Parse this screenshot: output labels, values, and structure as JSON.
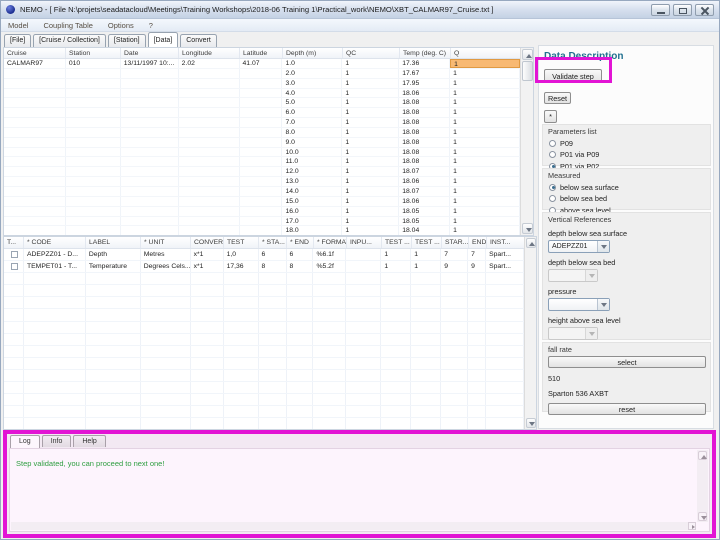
{
  "window": {
    "title": "NEMO - [ File N:\\projets\\seadatacloud\\Meetings\\Training Workshops\\2018-06 Training 1\\Practical_work\\NEMO\\XBT_CALMAR97_Cruise.txt ]"
  },
  "menu": {
    "items": [
      "Model",
      "Coupling Table",
      "Options",
      "?"
    ]
  },
  "tabs": {
    "items": [
      "[File]",
      "[Cruise / Collection]",
      "[Station]",
      "[Data]",
      "Convert"
    ],
    "active": "[Data]"
  },
  "data_table": {
    "columns": [
      "Cruise",
      "Station",
      "Date",
      "Longitude",
      "Latitude",
      "Depth (m)",
      "QC",
      "Temp (deg. C)",
      "Q"
    ],
    "station_info": {
      "cruise": "CALMAR97",
      "station": "010",
      "date": "13/11/1997 10:...",
      "longitude": "2.02",
      "latitude": "41.07"
    },
    "measurements": [
      {
        "depth": "1.0",
        "qc": "1",
        "temp": "17.36",
        "q": "1"
      },
      {
        "depth": "2.0",
        "qc": "1",
        "temp": "17.67",
        "q": "1"
      },
      {
        "depth": "3.0",
        "qc": "1",
        "temp": "17.95",
        "q": "1"
      },
      {
        "depth": "4.0",
        "qc": "1",
        "temp": "18.06",
        "q": "1"
      },
      {
        "depth": "5.0",
        "qc": "1",
        "temp": "18.08",
        "q": "1"
      },
      {
        "depth": "6.0",
        "qc": "1",
        "temp": "18.08",
        "q": "1"
      },
      {
        "depth": "7.0",
        "qc": "1",
        "temp": "18.08",
        "q": "1"
      },
      {
        "depth": "8.0",
        "qc": "1",
        "temp": "18.08",
        "q": "1"
      },
      {
        "depth": "9.0",
        "qc": "1",
        "temp": "18.08",
        "q": "1"
      },
      {
        "depth": "10.0",
        "qc": "1",
        "temp": "18.08",
        "q": "1"
      },
      {
        "depth": "11.0",
        "qc": "1",
        "temp": "18.08",
        "q": "1"
      },
      {
        "depth": "12.0",
        "qc": "1",
        "temp": "18.07",
        "q": "1"
      },
      {
        "depth": "13.0",
        "qc": "1",
        "temp": "18.06",
        "q": "1"
      },
      {
        "depth": "14.0",
        "qc": "1",
        "temp": "18.07",
        "q": "1"
      },
      {
        "depth": "15.0",
        "qc": "1",
        "temp": "18.06",
        "q": "1"
      },
      {
        "depth": "16.0",
        "qc": "1",
        "temp": "18.05",
        "q": "1"
      },
      {
        "depth": "17.0",
        "qc": "1",
        "temp": "18.05",
        "q": "1"
      },
      {
        "depth": "18.0",
        "qc": "1",
        "temp": "18.04",
        "q": "1"
      }
    ]
  },
  "param_table": {
    "columns": [
      "T...",
      "* CODE",
      "LABEL",
      "* UNIT",
      "CONVER...",
      "TEST",
      "* STA...",
      "* END",
      "* FORMAT",
      "INPU...",
      "TEST ...",
      "TEST ...",
      "STAR...",
      "END ...",
      "INST..."
    ],
    "rows": [
      [
        "ADEPZZ01 - D...",
        "Depth",
        "Metres",
        "x*1",
        "1,0",
        "6",
        "6",
        "%6.1f",
        "",
        "1",
        "1",
        "7",
        "7",
        "Spart..."
      ],
      [
        "TEMPET01 - T...",
        "Temperature",
        "Degrees Cels...",
        "x*1",
        "17,36",
        "8",
        "8",
        "%5.2f",
        "",
        "1",
        "1",
        "9",
        "9",
        "Spart..."
      ]
    ]
  },
  "panel": {
    "title": "Data Description",
    "validate_button": "Validate step",
    "reset_button": "Reset",
    "asterisk_button": "*",
    "parameters_list": {
      "label": "Parameters list",
      "options": [
        "P09",
        "P01 via P09",
        "P01 via P02"
      ],
      "selected": "P01 via P02"
    },
    "measured": {
      "label": "Measured",
      "options": [
        "below sea surface",
        "below sea bed",
        "above sea level"
      ],
      "selected": "below sea surface"
    },
    "vertical_references": {
      "label": "Vertical References",
      "fields": [
        {
          "label": "depth below sea surface",
          "value": "ADEPZZ01",
          "enabled": true
        },
        {
          "label": "depth below sea bed",
          "value": "",
          "enabled": false
        },
        {
          "label": "pressure",
          "value": "",
          "enabled": true
        },
        {
          "label": "height above sea level",
          "value": "",
          "enabled": false
        }
      ]
    },
    "fall_rate": {
      "label": "fall rate",
      "select_button": "select",
      "code": "510",
      "probe": "Sparton 536 AXBT",
      "reset_button": "reset"
    }
  },
  "log_panel": {
    "tabs": [
      "Log",
      "Info",
      "Help"
    ],
    "active_tab": "Log",
    "message": "Step validated, you can proceed to next one!"
  },
  "colors": {
    "annotation_highlight": "#e214d4",
    "selected_cell": "#f8b973",
    "log_message_text": "#2f9e41",
    "panel_title_text": "#20708f"
  }
}
